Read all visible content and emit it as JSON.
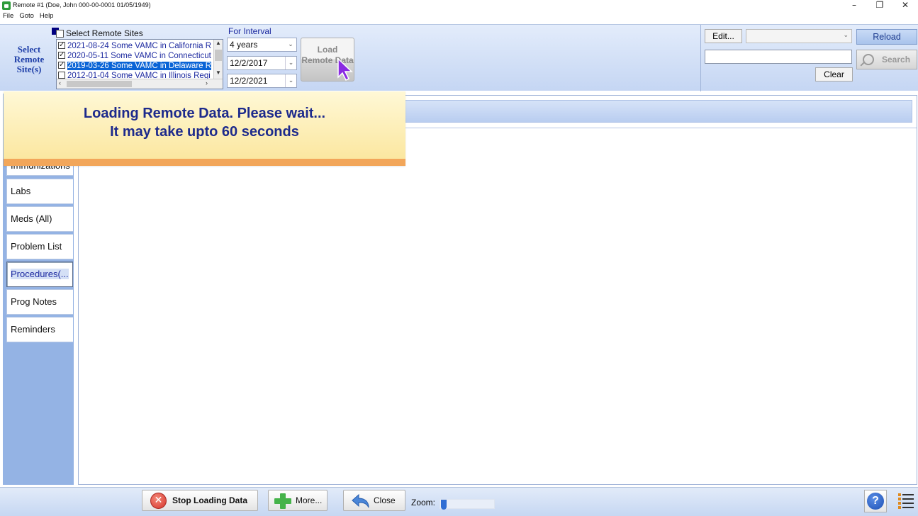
{
  "window": {
    "title": "Remote #1 (Doe, John  000-00-0001  01/05/1949)",
    "minimize_glyph": "–",
    "restore_glyph": "❐",
    "close_glyph": "✕"
  },
  "menu": [
    "File",
    "Goto",
    "Help"
  ],
  "toolbar": {
    "select_label": "Select Remote Site(s)",
    "sites_header": "Select Remote Sites",
    "sites": [
      {
        "label": "2021-08-24 Some VAMC in California R",
        "checked": true,
        "selected": false
      },
      {
        "label": "2020-05-11 Some VAMC in Connecticut",
        "checked": true,
        "selected": false
      },
      {
        "label": "2019-03-26 Some VAMC in Delaware R",
        "checked": true,
        "selected": true
      },
      {
        "label": "2012-01-04 Some VAMC in Illinois Regi",
        "checked": false,
        "selected": false
      }
    ],
    "interval_label": "For Interval",
    "interval_value": "4 years",
    "date_from": "12/2/2017",
    "date_to": "12/2/2021",
    "load_button": "Load Remote Data"
  },
  "right_panel": {
    "edit_label": "Edit...",
    "reload_label": "Reload",
    "search_value": "",
    "search_label": "Search",
    "clear_label": "Clear"
  },
  "nav": {
    "partial_label": "Immunizations",
    "items": [
      {
        "label": "Labs"
      },
      {
        "label": "Meds (All)"
      },
      {
        "label": "Problem List"
      },
      {
        "label": "Procedures(..."
      },
      {
        "label": "Prog Notes"
      },
      {
        "label": "Reminders"
      }
    ],
    "active_index": 3
  },
  "loading": {
    "line1": "Loading Remote Data. Please wait...",
    "line2": "It may take upto 60 seconds"
  },
  "bottom": {
    "stop_label": "Stop Loading Data",
    "more_label": "More...",
    "close_label": "Close",
    "zoom_label": "Zoom:",
    "help_glyph": "?"
  },
  "colors": {
    "accent": "#1d2aa0",
    "selection": "#0a64d6",
    "loading_bg": "#fbe7a0",
    "loading_border": "#f2a65a"
  }
}
